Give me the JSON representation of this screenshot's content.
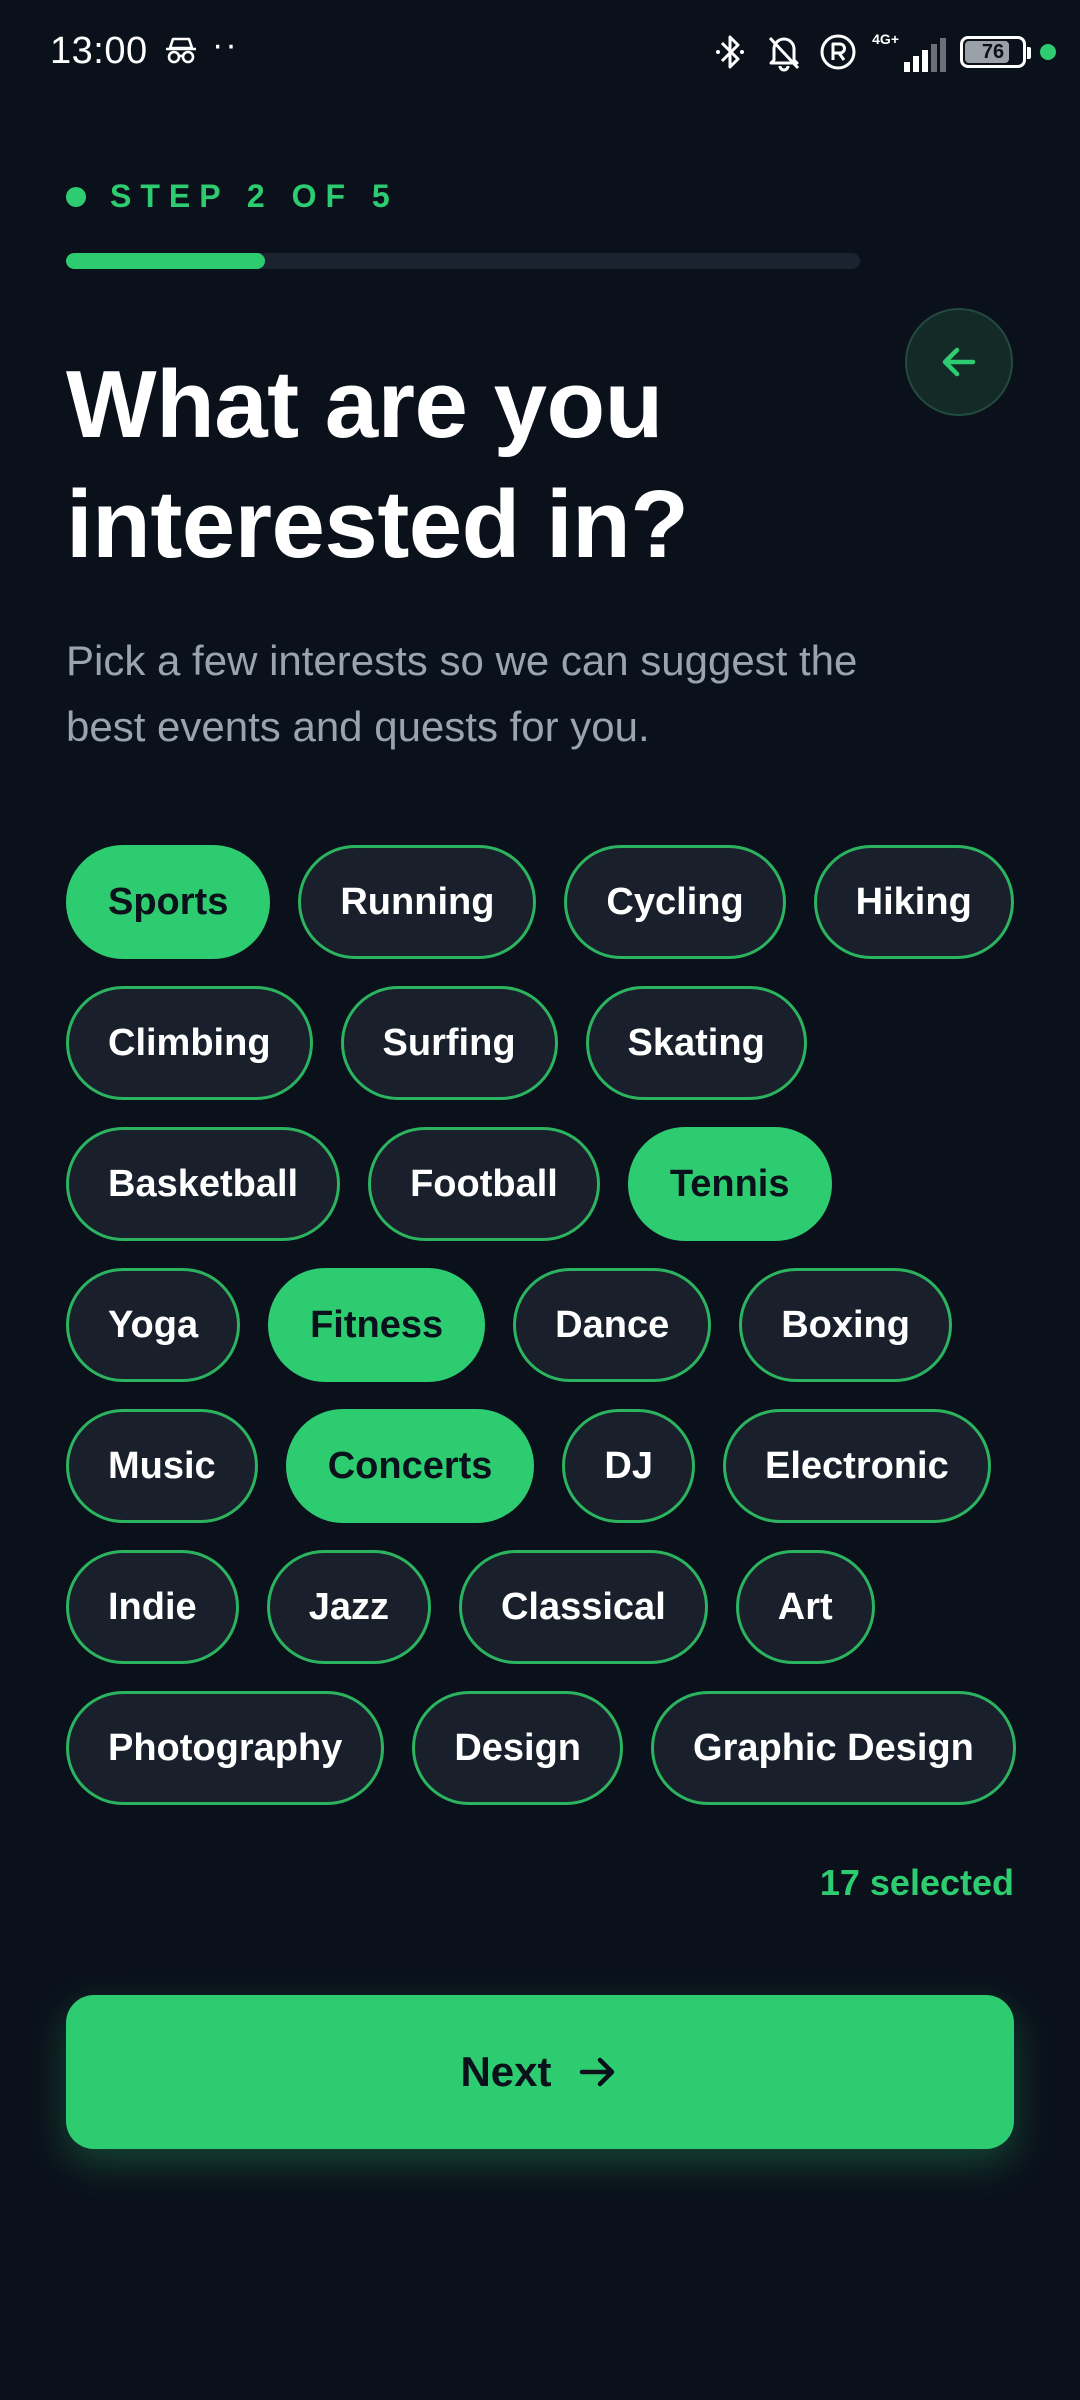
{
  "status_bar": {
    "time": "13:00",
    "dots": "··",
    "network": "4G+",
    "battery": "76",
    "icons": [
      "incognito-icon",
      "bluetooth-icon",
      "bell-off-icon",
      "registered-icon",
      "signal-icon",
      "battery-icon",
      "dot-icon"
    ]
  },
  "onboarding": {
    "step_label": "STEP 2 OF 5",
    "progress_fraction": 0.25,
    "title": "What are you interested in?",
    "subtitle": "Pick a few interests so we can suggest the best events and quests for you.",
    "back_icon": "arrow-left-icon"
  },
  "interests": {
    "rows": [
      [
        {
          "label": "Sports",
          "selected": true
        },
        {
          "label": "Running",
          "selected": false
        },
        {
          "label": "Cycling",
          "selected": false
        },
        {
          "label": "Hiking",
          "selected": false
        }
      ],
      [
        {
          "label": "Climbing",
          "selected": false
        },
        {
          "label": "Surfing",
          "selected": false
        },
        {
          "label": "Skating",
          "selected": false
        }
      ],
      [
        {
          "label": "Basketball",
          "selected": false
        },
        {
          "label": "Football",
          "selected": false
        },
        {
          "label": "Tennis",
          "selected": true
        }
      ],
      [
        {
          "label": "Yoga",
          "selected": false
        },
        {
          "label": "Fitness",
          "selected": true
        },
        {
          "label": "Dance",
          "selected": false
        },
        {
          "label": "Boxing",
          "selected": false
        }
      ],
      [
        {
          "label": "Music",
          "selected": false
        },
        {
          "label": "Concerts",
          "selected": true
        },
        {
          "label": "DJ",
          "selected": false
        },
        {
          "label": "Electronic",
          "selected": false
        }
      ],
      [
        {
          "label": "Indie",
          "selected": false
        },
        {
          "label": "Jazz",
          "selected": false
        },
        {
          "label": "Classical",
          "selected": false
        },
        {
          "label": "Art",
          "selected": false
        }
      ],
      [
        {
          "label": "Photography",
          "selected": false
        },
        {
          "label": "Design",
          "selected": false
        },
        {
          "label": "Graphic Design",
          "selected": false
        }
      ]
    ],
    "selected_count_text": "17 selected"
  },
  "footer": {
    "next_label": "Next",
    "next_icon": "arrow-right-icon"
  },
  "colors": {
    "accent": "#2ecc71",
    "background": "#0b111b",
    "chip_background": "#1a202b"
  }
}
